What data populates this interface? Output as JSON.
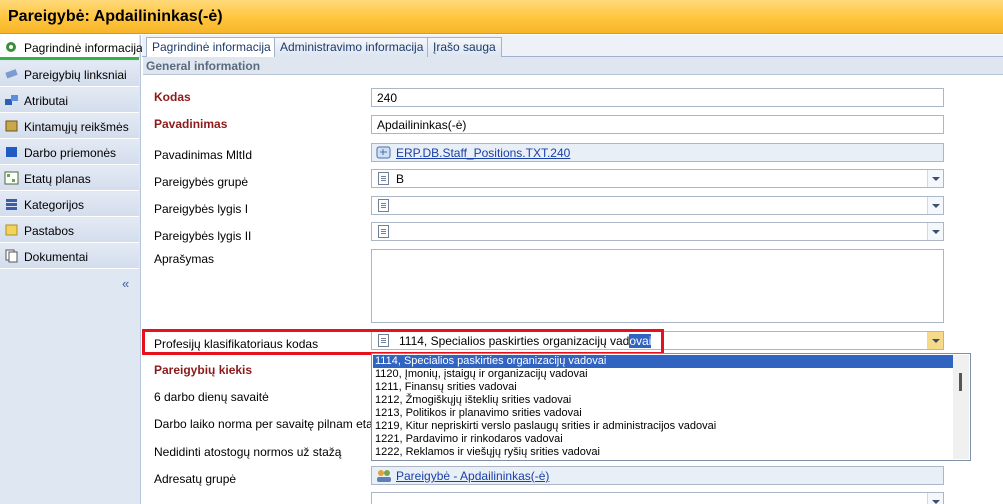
{
  "window": {
    "title": "Pareigybė: Apdailininkas(-ė)"
  },
  "sidebar": {
    "items": [
      {
        "label": "Pagrindinė informacija",
        "icon": "gear-icon"
      },
      {
        "label": "Pareigybių linksniai",
        "icon": "pencil-icon"
      },
      {
        "label": "Atributai",
        "icon": "attributes-icon"
      },
      {
        "label": "Kintamųjų reikšmės",
        "icon": "book-icon"
      },
      {
        "label": "Darbo priemonės",
        "icon": "cube-icon"
      },
      {
        "label": "Etatų planas",
        "icon": "table-icon"
      },
      {
        "label": "Kategorijos",
        "icon": "stack-icon"
      },
      {
        "label": "Pastabos",
        "icon": "note-icon"
      },
      {
        "label": "Dokumentai",
        "icon": "documents-icon"
      }
    ],
    "collapse": "«"
  },
  "tabs": [
    {
      "label": "Pagrindinė informacija"
    },
    {
      "label": "Administravimo informacija"
    },
    {
      "label": "Įrašo sauga"
    }
  ],
  "section": {
    "title": "General information"
  },
  "fields": {
    "kodas": {
      "label": "Kodas",
      "value": "240"
    },
    "pavadinimas": {
      "label": "Pavadinimas",
      "value": "Apdailininkas(-ė)"
    },
    "mltid": {
      "label": "Pavadinimas MltId",
      "value": "ERP.DB.Staff_Positions.TXT.240"
    },
    "grupe": {
      "label": "Pareigybės grupė",
      "value": "B"
    },
    "lygis1": {
      "label": "Pareigybės lygis I",
      "value": ""
    },
    "lygis2": {
      "label": "Pareigybės lygis II",
      "value": ""
    },
    "aprasymas": {
      "label": "Aprašymas",
      "value": ""
    },
    "prof_kodas": {
      "label": "Profesijų klasifikatoriaus kodas",
      "value_main": "1114, Specialios paskirties organizacijų vad",
      "value_selected": "ovai"
    },
    "kiekis": {
      "label": "Pareigybių kiekis"
    },
    "darbo_dienu": {
      "label": "6 darbo dienų savaitė"
    },
    "darbo_laiko": {
      "label": "Darbo laiko norma per savaitę pilnam etatui"
    },
    "nedidinti": {
      "label": "Nedidinti atostogų normos už stažą"
    },
    "adresatu": {
      "label": "Adresatų grupė",
      "value": "Pareigybė - Apdailininkas(-ė)"
    }
  },
  "dropdown": {
    "options": [
      "1114, Specialios paskirties organizacijų vadovai",
      "1120, Įmonių, įstaigų ir organizacijų vadovai",
      "1211, Finansų srities vadovai",
      "1212, Žmogiškųjų išteklių srities vadovai",
      "1213, Politikos ir planavimo srities vadovai",
      "1219, Kitur nepriskirti verslo paslaugų srities ir administracijos vadovai",
      "1221, Pardavimo ir rinkodaros vadovai",
      "1222, Reklamos ir viešųjų ryšių srities vadovai"
    ],
    "selected_index": 0
  },
  "colors": {
    "accent": "#ffc53d",
    "highlight": "#e5121d",
    "selection": "#3163c0"
  }
}
